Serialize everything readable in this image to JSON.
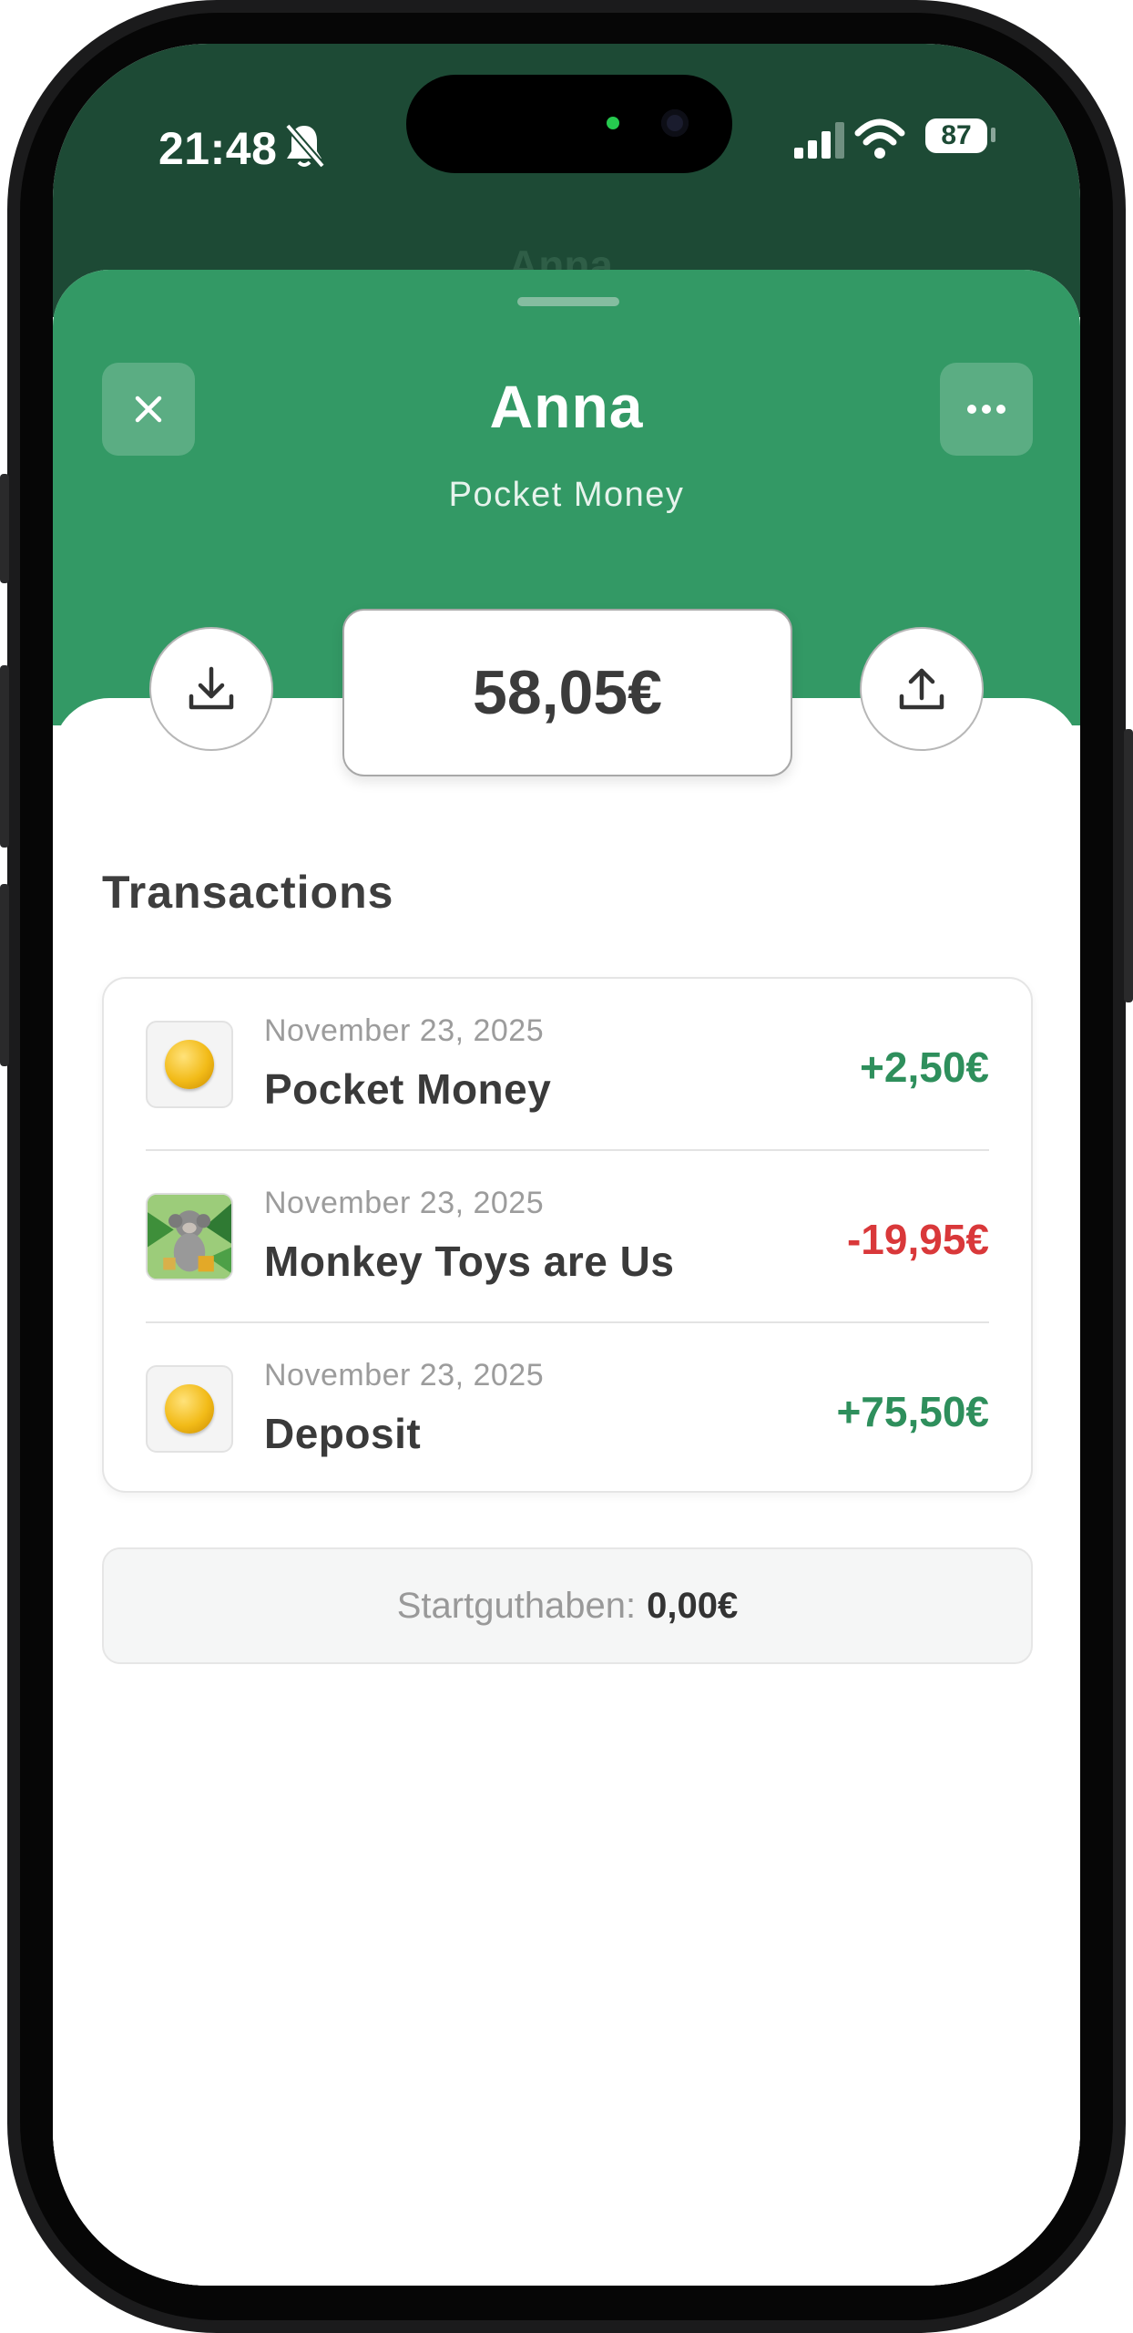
{
  "status_bar": {
    "time": "21:48",
    "battery": "87",
    "icons": [
      "bell-muted-icon",
      "signal-icon",
      "wifi-icon",
      "battery-icon"
    ]
  },
  "background_title": "Anna",
  "header": {
    "name": "Anna",
    "subtitle": "Pocket Money",
    "close_icon": "close-icon",
    "more_icon": "more-dots-icon",
    "color": "#339965"
  },
  "balance": {
    "amount": "58,05€",
    "deposit_icon": "download-icon",
    "withdraw_icon": "upload-icon"
  },
  "transactions": {
    "title": "Transactions",
    "items": [
      {
        "date": "November 23, 2025",
        "title": "Pocket Money",
        "amount": "+2,50€",
        "type": "credit",
        "icon": "coin-icon"
      },
      {
        "date": "November 23, 2025",
        "title": "Monkey Toys are Us",
        "amount": "-19,95€",
        "type": "debit",
        "icon": "toy-monkey-image"
      },
      {
        "date": "November 23, 2025",
        "title": "Deposit",
        "amount": "+75,50€",
        "type": "credit",
        "icon": "coin-icon"
      }
    ]
  },
  "starting_balance": {
    "label": "Startguthaben:",
    "value": "0,00€"
  },
  "colors": {
    "accent": "#339965",
    "status_bg": "#1d4a35",
    "positive": "#2e8f5c",
    "negative": "#d9383a"
  }
}
